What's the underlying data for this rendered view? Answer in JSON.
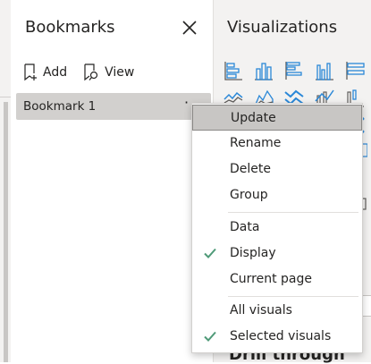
{
  "bookmarks_pane": {
    "title": "Bookmarks",
    "add_label": "Add",
    "view_label": "View",
    "items": [
      {
        "label": "Bookmark 1",
        "more": "·"
      }
    ]
  },
  "visualizations_pane": {
    "title": "Visualizations",
    "drill_title": "Drill through",
    "accent_color": "#2b88d8"
  },
  "context_menu": {
    "items": [
      {
        "label": "Update",
        "highlighted": true
      },
      {
        "label": "Rename"
      },
      {
        "label": "Delete"
      },
      {
        "label": "Group"
      },
      {
        "label": "Data"
      },
      {
        "label": "Display",
        "checked": true
      },
      {
        "label": "Current page"
      },
      {
        "label": "All visuals"
      },
      {
        "label": "Selected visuals",
        "checked": true
      }
    ],
    "check_color": "#4f9a78"
  }
}
